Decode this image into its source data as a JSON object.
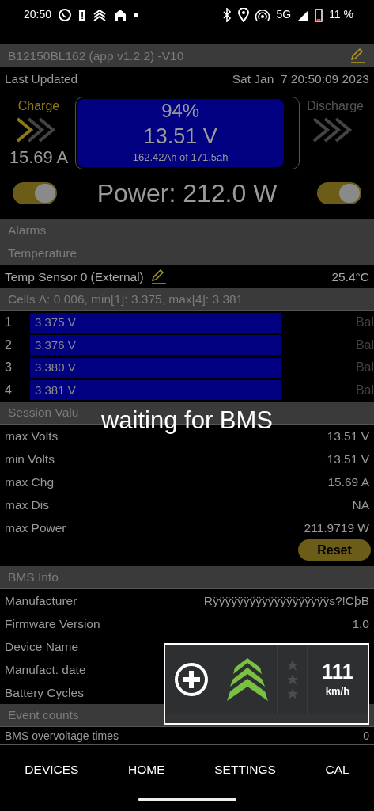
{
  "status_bar": {
    "time": "20:50",
    "network": "5G",
    "battery": "11 %"
  },
  "device_bar": {
    "title": "B12150BL162 (app v1.2.2) -V10"
  },
  "last_updated": {
    "label": "Last Updated",
    "value": "Sat Jan  7 20:50:09 2023"
  },
  "charge": {
    "label": "Charge",
    "current": "15.69 A",
    "arrows": [
      {
        "on": true
      },
      {
        "on": false
      },
      {
        "on": false
      }
    ]
  },
  "discharge": {
    "label": "Discharge",
    "arrows": [
      {
        "on": false
      },
      {
        "on": false
      },
      {
        "on": false
      }
    ]
  },
  "battery": {
    "percent": "94%",
    "voltage": "13.51 V",
    "capacity": "162.42Ah of 171.5ah",
    "level": 0.94
  },
  "power": {
    "text": "Power: 212.0 W",
    "charge_switch": {
      "on": true
    },
    "discharge_switch": {
      "on": true
    }
  },
  "alarms": {
    "title": "Alarms"
  },
  "temperature": {
    "title": "Temperature",
    "sensors": [
      {
        "name": "Temp Sensor 0 (External)",
        "value": "25.4°C"
      }
    ]
  },
  "cells": {
    "title": "Cells Δ: 0.006, min[1]: 3.375, max[4]: 3.381",
    "rows": [
      {
        "index": "1",
        "voltage": "3.375 V",
        "balance": "Bal"
      },
      {
        "index": "2",
        "voltage": "3.376 V",
        "balance": "Bal"
      },
      {
        "index": "3",
        "voltage": "3.380 V",
        "balance": "Bal"
      },
      {
        "index": "4",
        "voltage": "3.381 V",
        "balance": "Bal"
      }
    ]
  },
  "session": {
    "title": "Session Valu",
    "rows": [
      {
        "label": "max Volts",
        "value": "13.51 V"
      },
      {
        "label": "min Volts",
        "value": "13.51 V"
      },
      {
        "label": "max Chg",
        "value": "15.69 A"
      },
      {
        "label": "max Dis",
        "value": "NA"
      },
      {
        "label": "max Power",
        "value": "211.9719 W"
      }
    ],
    "button": "Reset"
  },
  "bms_info": {
    "title": "BMS Info",
    "rows": [
      {
        "label": "Manufacturer",
        "value": "Rÿÿÿÿÿÿÿÿÿÿÿÿÿÿÿÿÿÿÿs?!CþB"
      },
      {
        "label": "Firmware Version",
        "value": "1.0"
      },
      {
        "label": "Device Name"
      },
      {
        "label": "Manufact. date"
      },
      {
        "label": "Battery Cycles"
      }
    ]
  },
  "event_counts": {
    "title": "Event counts",
    "rows": [
      {
        "label": "BMS overvoltage times",
        "value": "0"
      }
    ]
  },
  "toast": "waiting for BMS",
  "speed_widget": {
    "speed": "111",
    "unit": "km/h"
  },
  "bottom_nav": [
    {
      "label": "DEVICES"
    },
    {
      "label": "HOME"
    },
    {
      "label": "SETTINGS"
    },
    {
      "label": "CAL"
    }
  ]
}
